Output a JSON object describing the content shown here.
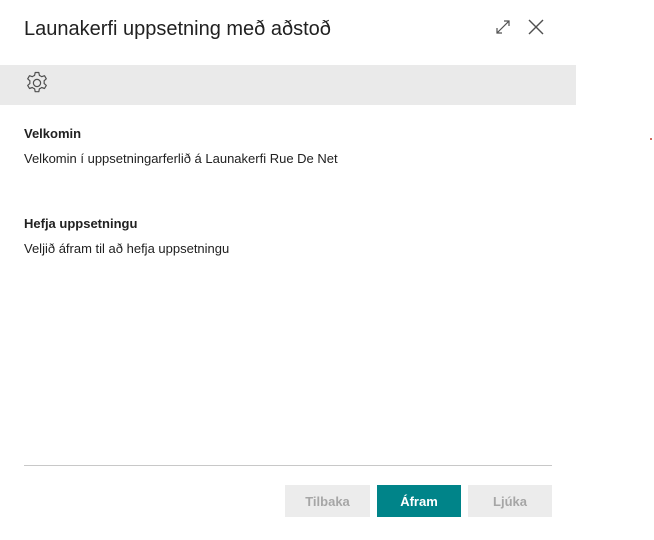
{
  "dialog": {
    "title": "Launakerfi uppsetning með aðstoð",
    "expand_icon": "expand-icon",
    "close_icon": "close-icon"
  },
  "toolbar": {
    "settings_icon": "gear-icon"
  },
  "sections": [
    {
      "heading": "Velkomin",
      "text": "Velkomin í uppsetningarferlið á Launakerfi Rue De Net"
    },
    {
      "heading": "Hefja uppsetningu",
      "text": "Veljið áfram til að hefja uppsetningu"
    }
  ],
  "footer": {
    "back_label": "Tilbaka",
    "next_label": "Áfram",
    "finish_label": "Ljúka"
  },
  "colors": {
    "accent": "#008489",
    "toolbar_bg": "#eaeaea",
    "disabled_bg": "#ececec",
    "disabled_text": "#a6a6a6"
  }
}
